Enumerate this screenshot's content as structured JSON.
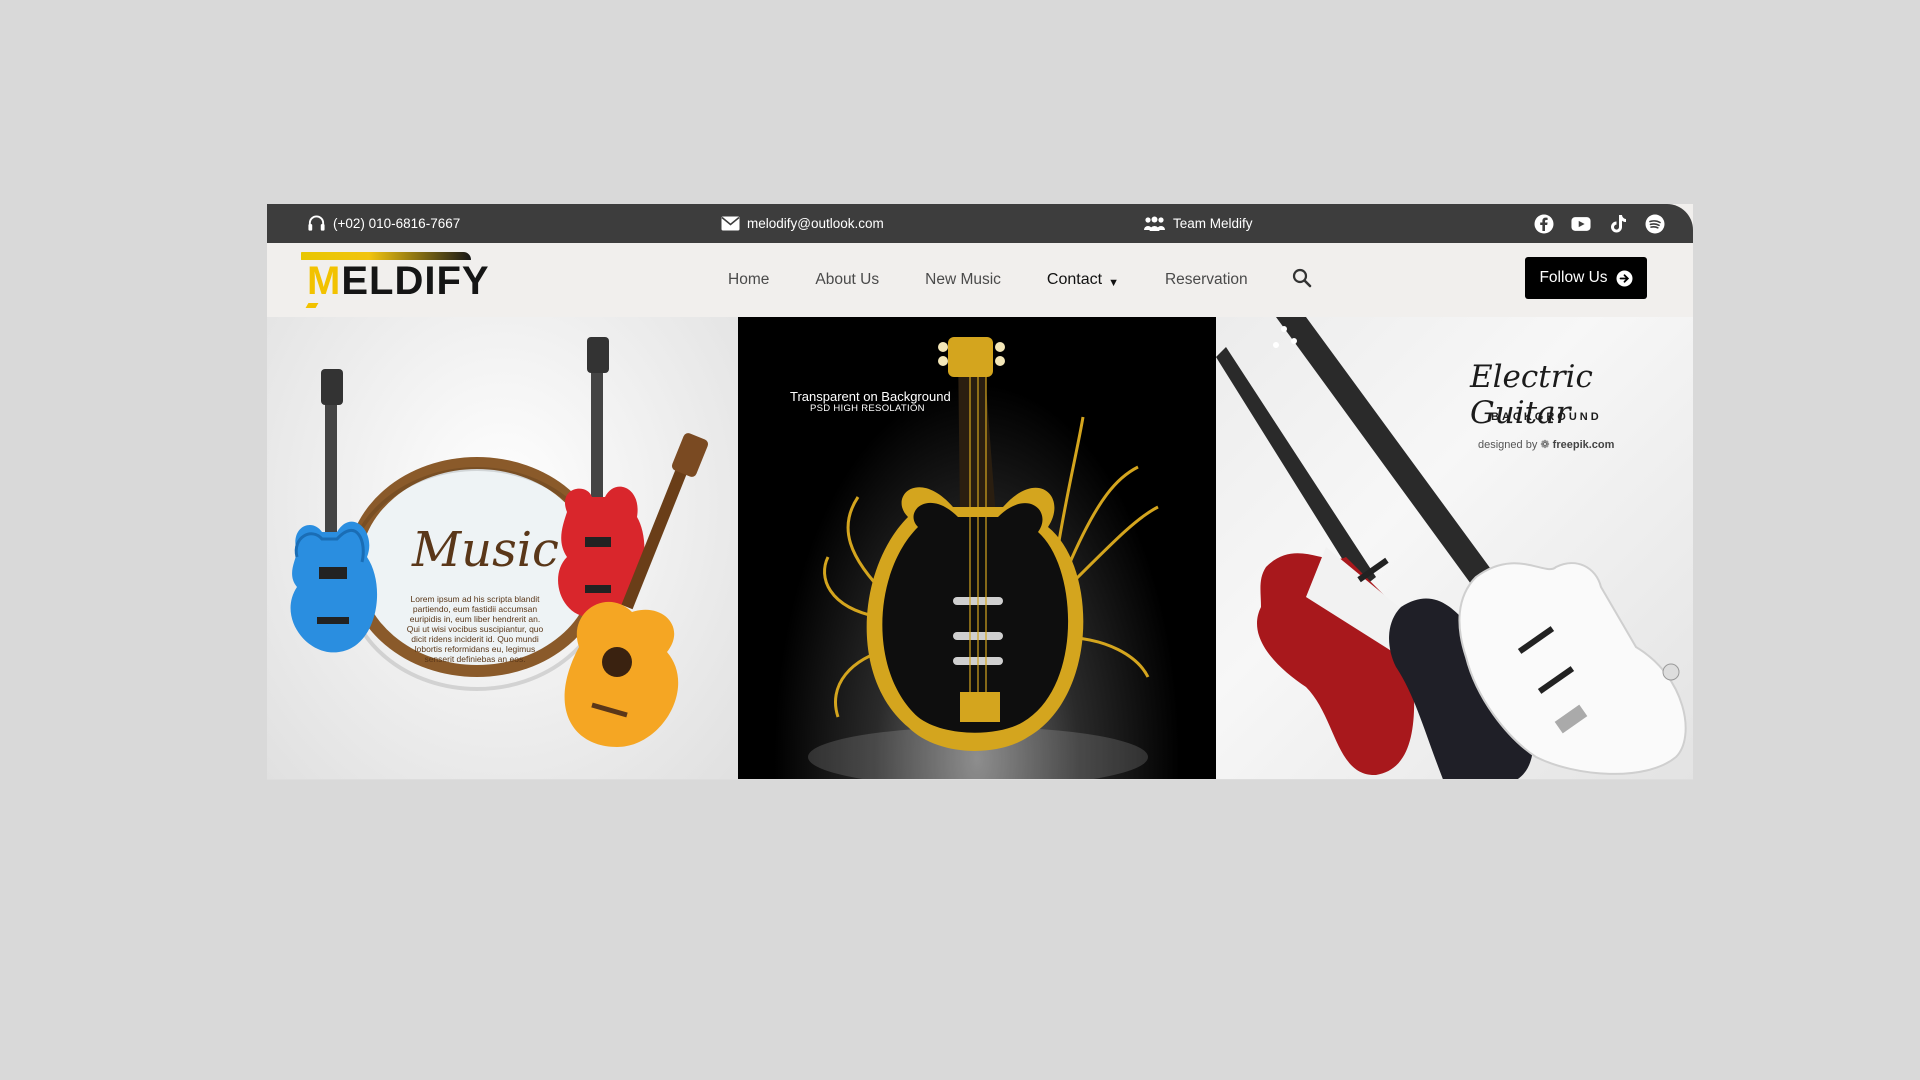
{
  "topbar": {
    "phone": "(+02) 010-6816-7667",
    "email": "melodify@outlook.com",
    "team": "Team Meldify",
    "socials": [
      "facebook-icon",
      "youtube-icon",
      "tiktok-icon",
      "spotify-icon"
    ]
  },
  "logo": {
    "first_letter": "M",
    "rest": "ELDIFY"
  },
  "nav": {
    "links": [
      "Home",
      "About Us",
      "New Music",
      "Contact",
      "Reservation"
    ],
    "active": "Contact",
    "follow_label": "Follow Us"
  },
  "panels": {
    "music": {
      "title": "Music",
      "body": "Lorem ipsum ad his scripta blandit partiendo, eum fastidii accumsan euripidis in, eum liber hendrerit an. Qui ut wisi vocibus suscipiantur, quo dicit ridens inciderit id. Quo mundi lobortis reformidans eu, legimus senserit definiebas an eos."
    },
    "gold_guitar": {
      "caption": "Transparent on Background",
      "subcaption": "PSD HIGH RESOLATION"
    },
    "electric": {
      "title": "Electric Guitar",
      "subtitle": "BACKGROUND",
      "credit_prefix": "designed by",
      "credit_site": "freepik.com"
    }
  },
  "colors": {
    "topbar": "#3d3d3d",
    "accent": "#f2c200",
    "button": "#000000",
    "page_bg": "#d9d9d9"
  }
}
